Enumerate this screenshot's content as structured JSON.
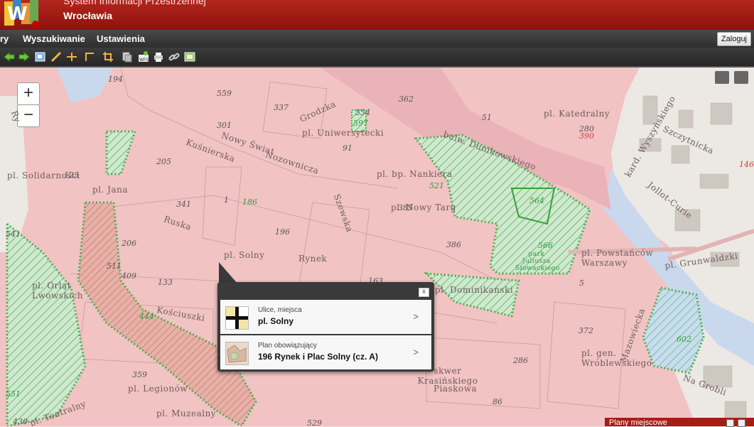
{
  "header": {
    "title_line1": "System Informacji Przestrzennej",
    "title_line2": "Wrocławia"
  },
  "menu": {
    "items": [
      "ry",
      "Wyszukiwanie",
      "Ustawienia"
    ],
    "login_label": "Zaloguj"
  },
  "toolbar": {
    "icons": [
      "arrow-back-icon",
      "arrow-forward-icon",
      "map-icon",
      "pencil-icon",
      "measure-distance-icon",
      "measure-angle-icon",
      "crop-icon",
      "layers-icon",
      "wfs-add-icon",
      "print-icon",
      "link-icon",
      "export-icon"
    ]
  },
  "map": {
    "zoom_in": "+",
    "zoom_out": "−",
    "streets": [
      "pl. Solidarności",
      "pl. Jana",
      "pl. Uniwersytecki",
      "Nowy Świat",
      "Nozownicza",
      "pl. bp. Nankiera",
      "pl. Nowy Targ",
      "bulw. Dunikowskiego",
      "pl. Katedralny",
      "Szczytnicka",
      "kard. Wyszyńskiego",
      "Jollot-Curie",
      "Grodzka",
      "pl. Solny",
      "Rynek",
      "Ruska",
      "Szewska",
      "pl. Orląt Lwowskich",
      "pl. Dominikański",
      "park Juliusza Słowackiego",
      "pl. Powstańców Warszawy",
      "pl. Grunwaldzki",
      "pl. gen. Wróblewskiego",
      "skwer Krasińskiego",
      "pl. Legionów",
      "pl. Muzealny",
      "Mazowiecka",
      "Na Grobli",
      "Kościuszki",
      "Kuśnierska",
      "pl. Teatralny",
      "Piaskowa"
    ],
    "numbers": [
      "194",
      "559",
      "337",
      "301",
      "554",
      "597",
      "362",
      "51",
      "280",
      "390",
      "205",
      "91",
      "123",
      "521",
      "341",
      "1",
      "186",
      "385",
      "564",
      "196",
      "206",
      "386",
      "566",
      "541",
      "511",
      "409",
      "133",
      "163",
      "5",
      "444",
      "372",
      "602",
      "359",
      "286",
      "551",
      "430",
      "529",
      "86",
      "146",
      "Ry"
    ]
  },
  "popup": {
    "close_label": "x",
    "rows": [
      {
        "sub": "Ulice, miejsca",
        "main": "pl. Solny",
        "arrow": ">"
      },
      {
        "sub": "Plan obowiązujący",
        "main": "196 Rynek i Plac Solny (cz. A)",
        "arrow": ">"
      }
    ]
  },
  "panel": {
    "title": "Plany miejscowe"
  },
  "colors": {
    "header": "#a51e16",
    "plan_area": "#f2c3c3",
    "green_area": "#5cb85c",
    "river": "#cad8ee",
    "popup_bg": "#3a3a3a"
  }
}
